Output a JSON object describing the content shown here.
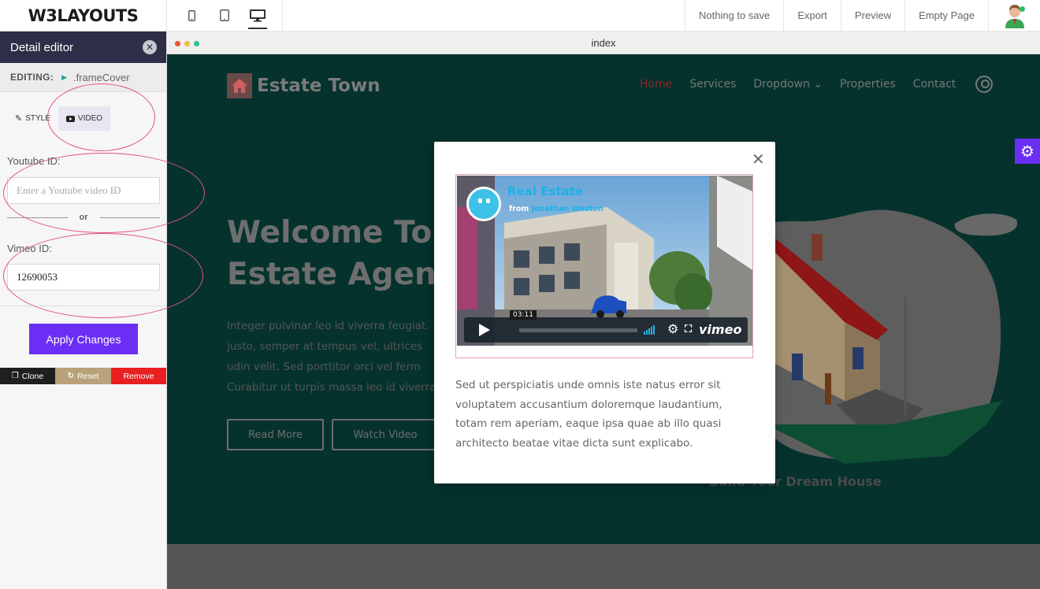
{
  "app": {
    "logo": "W3LAYOUTS",
    "devices": [
      {
        "name": "mobile",
        "active": false
      },
      {
        "name": "tablet",
        "active": false
      },
      {
        "name": "desktop",
        "active": true
      }
    ],
    "actions": [
      "Nothing to save",
      "Export",
      "Preview",
      "Empty Page"
    ]
  },
  "panel": {
    "title": "Detail editor",
    "editing_label": "EDITING:",
    "editing_target": ".frameCover",
    "tabs": [
      {
        "label": "STYLE",
        "icon": "edit-icon",
        "active": false
      },
      {
        "label": "VIDEO",
        "icon": "video-icon",
        "active": true
      }
    ],
    "youtube_label": "Youtube ID:",
    "youtube_placeholder": "Enter a Youtube video ID",
    "youtube_value": "",
    "or_text": "or",
    "vimeo_label": "Vimeo ID:",
    "vimeo_value": "12690053",
    "apply_label": "Apply Changes",
    "buttons": {
      "clone": "Clone",
      "reset": "Reset",
      "remove": "Remove"
    }
  },
  "browser": {
    "title": "index",
    "dots": [
      "#e9573f",
      "#f6bb42",
      "#37bc9b"
    ]
  },
  "site": {
    "brand": "Estate Town",
    "nav": [
      {
        "label": "Home",
        "active": true
      },
      {
        "label": "Services",
        "active": false
      },
      {
        "label": "Dropdown ⌄",
        "active": false
      },
      {
        "label": "Properties",
        "active": false
      },
      {
        "label": "Contact",
        "active": false
      }
    ],
    "hero_lines": [
      "Welcome To",
      "Estate Agency"
    ],
    "hero_text_lines": [
      "Integer pulvinar leo id viverra feugiat.",
      "justo, semper at tempus vel, ultrices",
      "udin velit. Sed porttitor orci vel ferm",
      "Curabitur ut turpis massa leo id viverra."
    ],
    "read_more": "Read More",
    "watch_video": "Watch Video",
    "dream": "Build Your Dream House"
  },
  "modal": {
    "video": {
      "title": "Real Estate",
      "from_prefix": "from",
      "author": "Jonathan Weston",
      "time": "03:11",
      "brand": "vimeo"
    },
    "text_lines": [
      "Sed ut perspiciatis unde omnis iste natus error sit",
      "voluptatem accusantium doloremque laudantium,",
      "totam rem aperiam, eaque ipsa quae ab illo quasi",
      "architecto beatae vitae dicta sunt explicabo."
    ]
  },
  "colors": {
    "panel_header": "#2e2e48",
    "accent": "#6b2ef5",
    "site_bg": "#05322d",
    "annotation": "#e0508a",
    "clone": "#1f1f1f",
    "reset": "#b9a17a",
    "remove": "#e82020"
  }
}
